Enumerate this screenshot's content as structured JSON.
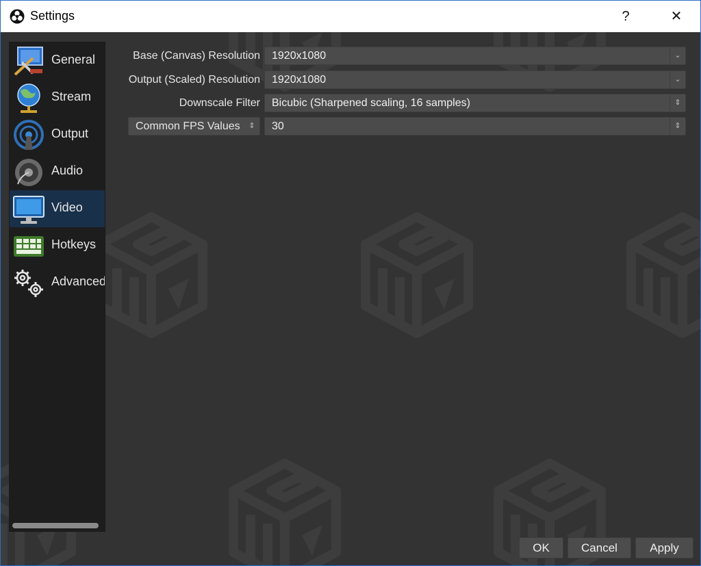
{
  "window": {
    "title": "Settings",
    "help_label": "?",
    "close_label": "✕"
  },
  "sidebar": {
    "items": [
      {
        "label": "General",
        "icon": "general-icon"
      },
      {
        "label": "Stream",
        "icon": "globe-icon"
      },
      {
        "label": "Output",
        "icon": "antenna-icon"
      },
      {
        "label": "Audio",
        "icon": "speaker-icon"
      },
      {
        "label": "Video",
        "icon": "monitor-icon",
        "selected": true
      },
      {
        "label": "Hotkeys",
        "icon": "keyboard-icon"
      },
      {
        "label": "Advanced",
        "icon": "gears-icon"
      }
    ]
  },
  "video": {
    "base_resolution": {
      "label": "Base (Canvas) Resolution",
      "value": "1920x1080"
    },
    "output_resolution": {
      "label": "Output (Scaled) Resolution",
      "value": "1920x1080"
    },
    "downscale_filter": {
      "label": "Downscale Filter",
      "value": "Bicubic (Sharpened scaling, 16 samples)"
    },
    "fps": {
      "mode": "Common FPS Values",
      "value": "30"
    }
  },
  "buttons": {
    "ok": "OK",
    "cancel": "Cancel",
    "apply": "Apply"
  },
  "colors": {
    "background": "#333333",
    "sidebar": "#1d1d1d",
    "selected": "#19304a",
    "input": "#4b4b4b"
  }
}
